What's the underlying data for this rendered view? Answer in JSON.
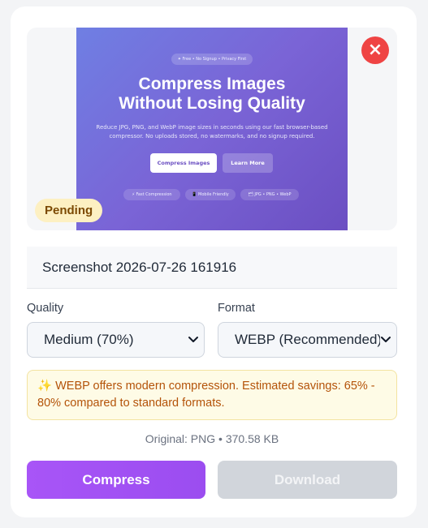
{
  "preview": {
    "thumbnail": {
      "badge": "✦ Free • No Signup • Privacy First",
      "title_line1": "Compress Images",
      "title_line2": "Without Losing Quality",
      "subtitle": "Reduce JPG, PNG, and WebP image sizes in seconds using our fast browser-based compressor. No uploads stored, no watermarks, and no signup required.",
      "primary_button": "Compress Images",
      "secondary_button": "Learn More",
      "pills": [
        "⚡ Fast Compression",
        "📱 Mobile Friendly",
        "🗂 JPG • PNG • WebP"
      ]
    },
    "close_icon": "×",
    "status": "Pending"
  },
  "file": {
    "name": "Screenshot 2026-07-26 161916"
  },
  "quality": {
    "label": "Quality",
    "selected": "Medium (70%)"
  },
  "format": {
    "label": "Format",
    "selected": "WEBP (Recommended)"
  },
  "info": {
    "icon": "✨",
    "text": "WEBP offers modern compression. Estimated savings: 65% - 80% compared to standard formats."
  },
  "meta": {
    "original": "Original: PNG • 370.58 KB"
  },
  "actions": {
    "compress": "Compress",
    "download": "Download"
  },
  "colors": {
    "accent": "#a855f7",
    "danger": "#ef4444",
    "pending_bg": "#fdf0c2",
    "info_text": "#b45309",
    "disabled": "#d1d5db"
  }
}
